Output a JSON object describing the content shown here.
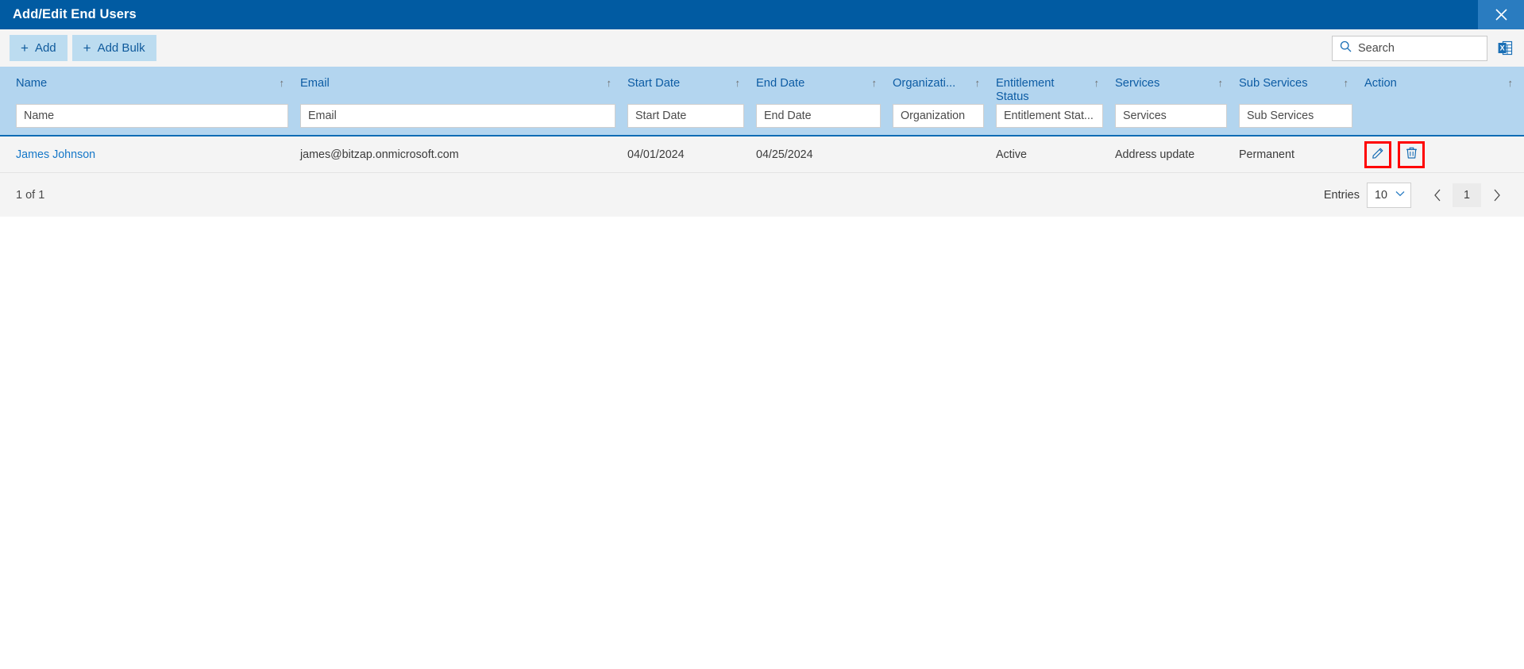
{
  "window": {
    "title": "Add/Edit End Users",
    "close_icon": "close-icon"
  },
  "toolbar": {
    "add_label": "Add",
    "add_bulk_label": "Add Bulk",
    "plus_glyph": "+",
    "search": {
      "placeholder": "Search",
      "value": "",
      "icon": "search-icon"
    },
    "export_icon": "excel-export-icon"
  },
  "table": {
    "sort_glyph": "↑",
    "columns": [
      {
        "label": "Name",
        "filter_placeholder": "Name",
        "sortable": true
      },
      {
        "label": "Email",
        "filter_placeholder": "Email",
        "sortable": true
      },
      {
        "label": "Start Date",
        "filter_placeholder": "Start Date",
        "sortable": true
      },
      {
        "label": "End Date",
        "filter_placeholder": "End Date",
        "sortable": true
      },
      {
        "label": "Organizati...",
        "filter_placeholder": "Organization",
        "sortable": true
      },
      {
        "label": "Entitlement Status",
        "filter_placeholder": "Entitlement Stat...",
        "sortable": true
      },
      {
        "label": "Services",
        "filter_placeholder": "Services",
        "sortable": true
      },
      {
        "label": "Sub Services",
        "filter_placeholder": "Sub Services",
        "sortable": true
      },
      {
        "label": "Action",
        "filter_placeholder": "",
        "sortable": true
      }
    ],
    "rows": [
      {
        "name": "James Johnson",
        "email": "james@bitzap.onmicrosoft.com",
        "start_date": "04/01/2024",
        "end_date": "04/25/2024",
        "organization": "",
        "entitlement_status": "Active",
        "services": "Address update",
        "sub_services": "Permanent",
        "actions": {
          "edit_icon": "edit-pencil-icon",
          "delete_icon": "delete-trash-icon"
        }
      }
    ]
  },
  "footer": {
    "count_text": "1 of 1",
    "entries_label": "Entries",
    "entries_value": "10",
    "prev_glyph": "‹",
    "page_number": "1",
    "next_glyph": "›"
  },
  "colors": {
    "titlebar_blue": "#015ba2",
    "header_blue": "#b3d5ef",
    "header_text": "#0d5ca4",
    "link_blue": "#1577c8",
    "annotation_red": "#ff0000",
    "button_blue": "#bcdcf0"
  }
}
